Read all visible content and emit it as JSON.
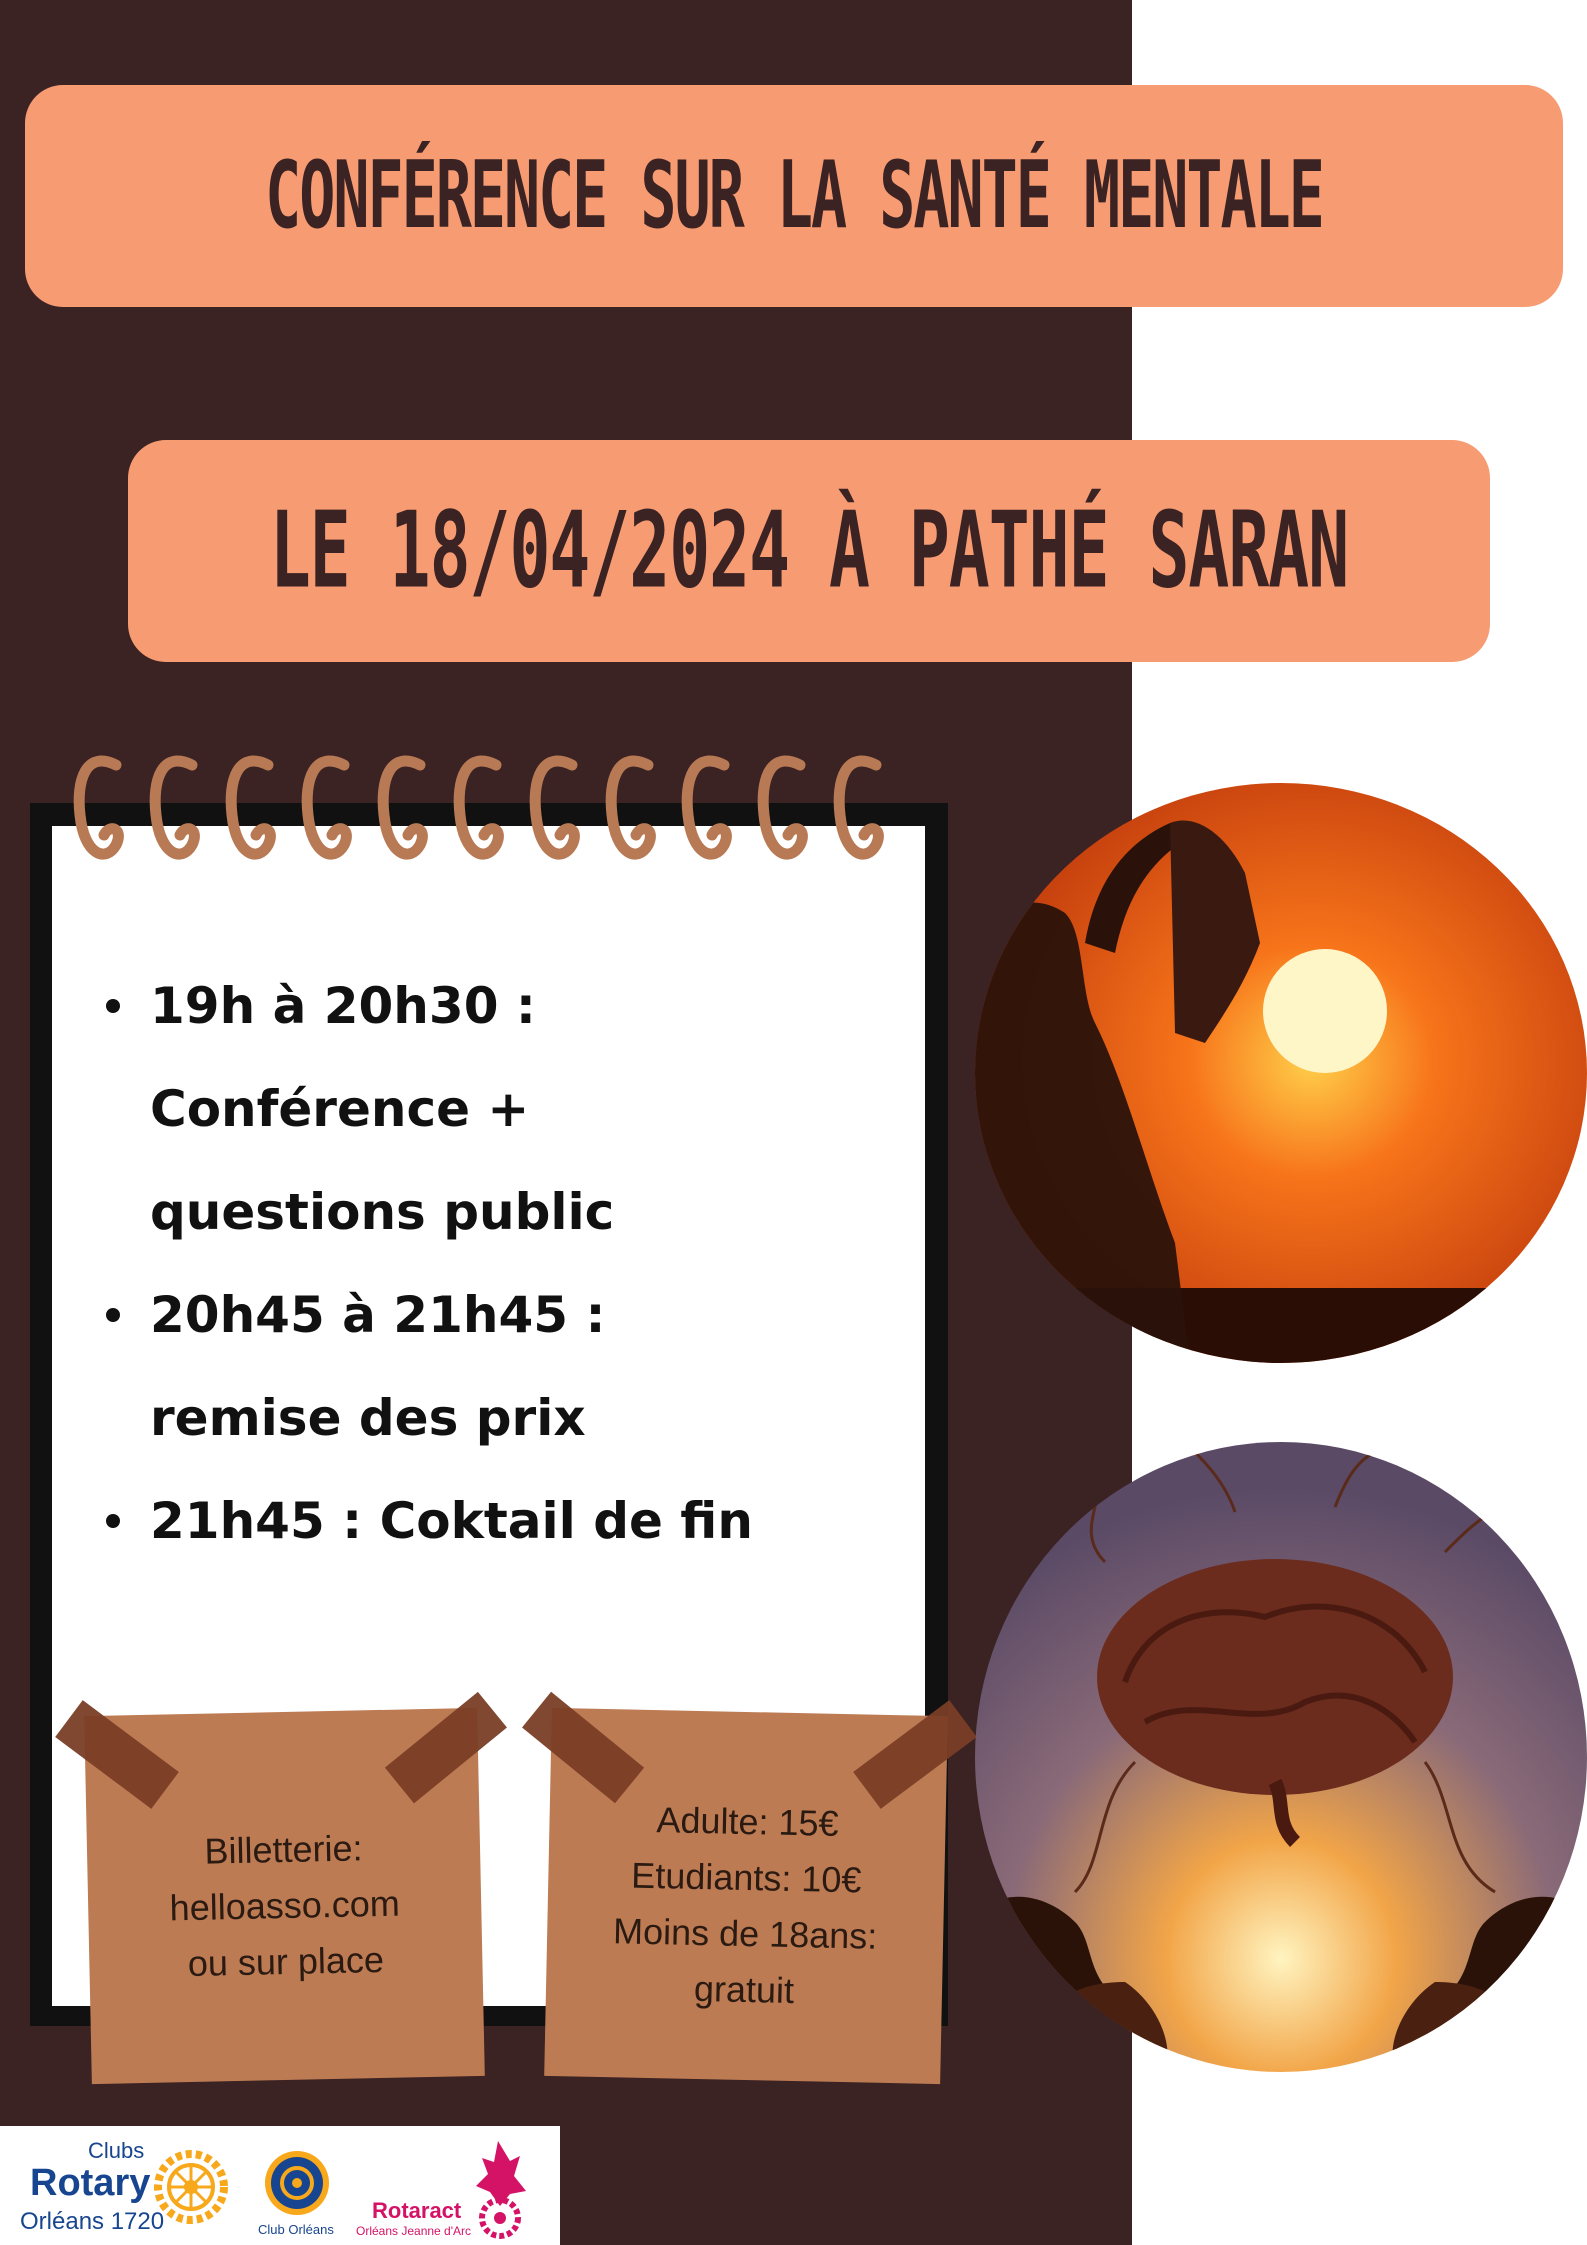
{
  "header": {
    "title": "Conférence sur la santé mentale",
    "date_place": "Le 18/04/2024 à Pathé Saran"
  },
  "agenda": [
    {
      "line1": "19h à 20h30 :",
      "line2": "Conférence +",
      "line3": "questions public"
    },
    {
      "line1": "20h45 à 21h45 :",
      "line2": "remise des prix"
    },
    {
      "line1": "21h45 : Coktail de fin"
    }
  ],
  "ticketing": {
    "line1": "Billetterie:",
    "line2": "helloasso.com",
    "line3": "ou sur place"
  },
  "prices": {
    "line1": "Adulte: 15€",
    "line2": "Etudiants: 10€",
    "line3": "Moins de 18ans:",
    "line4": "gratuit"
  },
  "logos": {
    "rotary_clubs": "Clubs",
    "rotary_name": "Rotary",
    "rotary_city": "Orléans 1720",
    "club_orleans": "Club Orléans",
    "rotaract_name": "Rotaract",
    "rotaract_sub": "Orléans Jeanne d'Arc"
  },
  "colors": {
    "background_dark": "#3b2223",
    "banner": "#f79b72",
    "note": "#bd7b53",
    "rings": "#b87a55",
    "rotary_blue": "#17458f",
    "rotary_gold": "#f7a81b",
    "rotaract_pink": "#d41367"
  },
  "icons": [
    "spiral-ring-icon",
    "sunset-photo",
    "brain-photo",
    "rotary-wheel-icon",
    "rotaract-logo-icon"
  ]
}
